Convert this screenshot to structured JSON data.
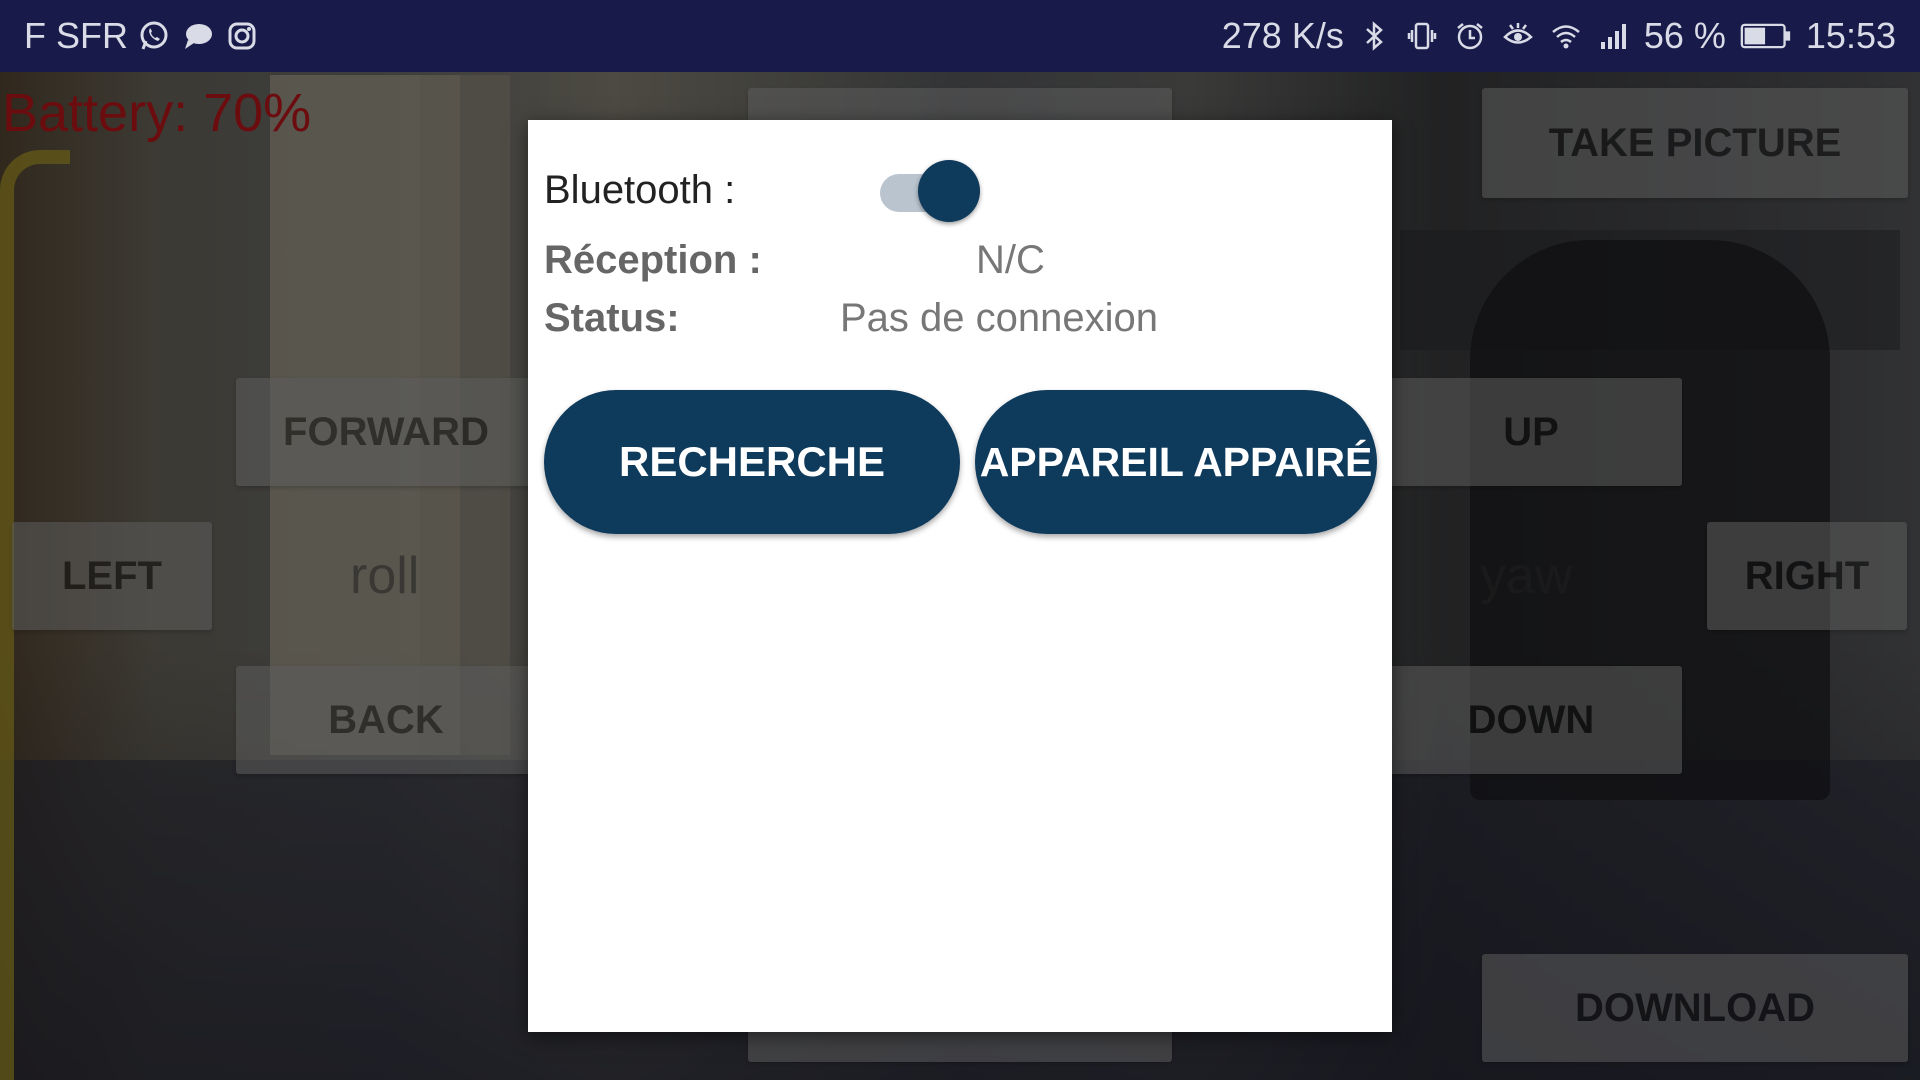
{
  "status_bar": {
    "carrier": "F SFR",
    "left_icons": [
      "whatsapp-icon",
      "message-icon",
      "instagram-icon"
    ],
    "network_speed": "278 K/s",
    "right_icons": [
      "bluetooth-icon",
      "vibrate-icon",
      "alarm-icon",
      "eye-comfort-icon",
      "wifi-icon",
      "signal-icon"
    ],
    "battery_percent": "56 %",
    "battery_level": 0.56,
    "time": "15:53",
    "background_color": "#181a4a"
  },
  "app": {
    "battery_label": "Battery: 70%",
    "controls": {
      "forward": "FORWARD",
      "back": "BACK",
      "left": "LEFT",
      "right": "RIGHT",
      "up": "UP",
      "down": "DOWN",
      "take_picture": "TAKE PICTURE",
      "download": "DOWNLOAD",
      "roll_label": "roll",
      "yaw_label": "yaw"
    }
  },
  "dialog": {
    "bluetooth_label": "Bluetooth :",
    "bluetooth_enabled": true,
    "reception_label": "Réception :",
    "reception_value": "N/C",
    "status_label": "Status:",
    "status_value": "Pas de connexion",
    "search_button": "RECHERCHE",
    "paired_button": "APPAREIL APPAIRÉ",
    "accent_color": "#0e3a5c"
  }
}
